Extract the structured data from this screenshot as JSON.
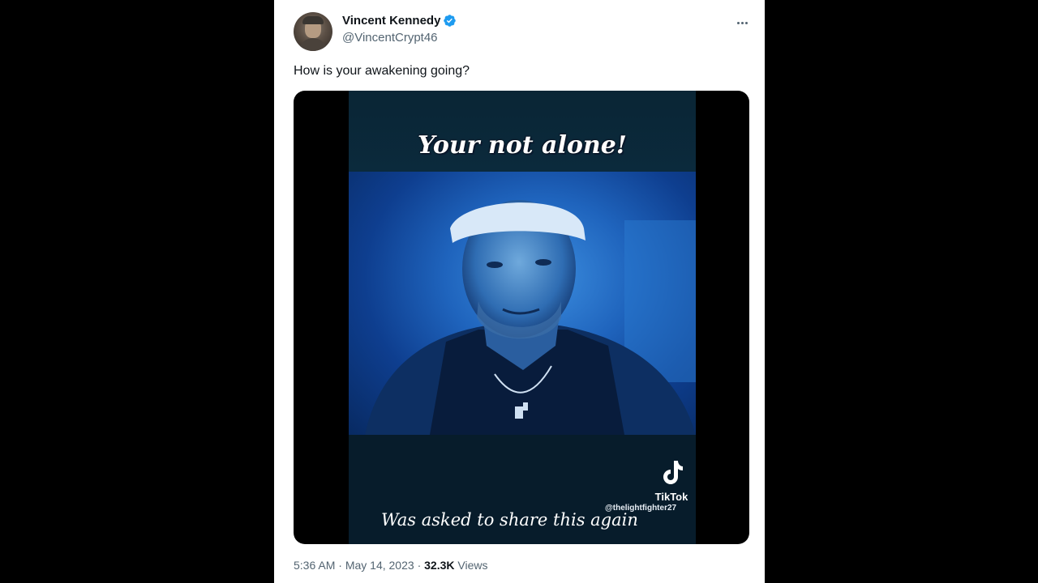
{
  "author": {
    "name": "Vincent Kennedy",
    "handle": "@VincentCrypt46",
    "verified_color": "#1d9bf0"
  },
  "tweet": {
    "text": "How is your awakening going?",
    "more_icon": "ellipsis-icon"
  },
  "video": {
    "caption_top": "Your not alone!",
    "caption_bottom": "Was asked to share this again",
    "watermark_brand": "TikTok",
    "watermark_user": "@thelightfighter27"
  },
  "meta": {
    "time": "5:36 AM",
    "separator": "·",
    "date": "May 14, 2023",
    "views_count": "32.3K",
    "views_label": "Views"
  }
}
